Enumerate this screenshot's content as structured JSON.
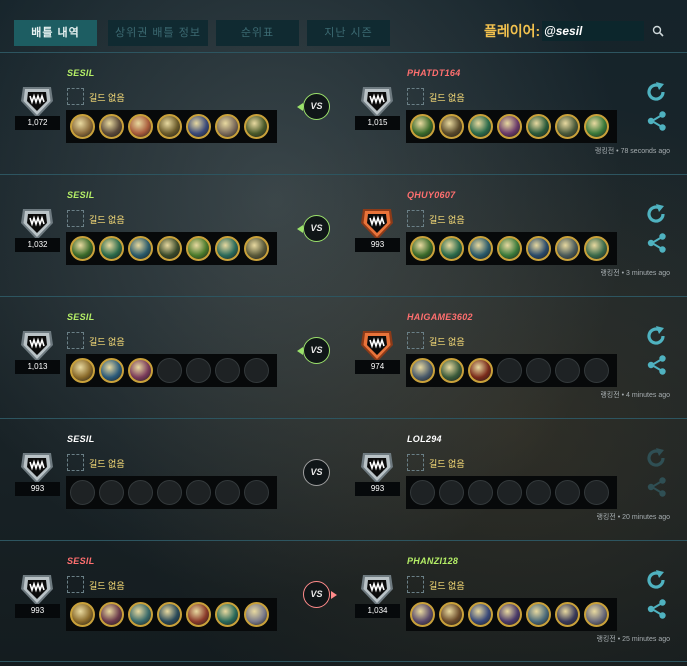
{
  "nav": {
    "tabs": [
      {
        "label": "배틀 내역",
        "active": true
      },
      {
        "label": "상위권 배틀 정보",
        "active": false
      },
      {
        "label": "순위표",
        "active": false
      },
      {
        "label": "지난 시즌",
        "active": false
      }
    ],
    "player_label": "플레이어:",
    "player_name": "@sesil",
    "search_icon": "search-icon"
  },
  "colors": {
    "accent": "#1d5d62",
    "win_name": "#b5ef67",
    "lose_name": "#ff6f6f",
    "neutral_name": "#ffffff",
    "guild_text": "#ffe27a"
  },
  "battles": [
    {
      "left": {
        "name": "SESIL",
        "result": "win",
        "rating": "1,072",
        "guild": "길드 없음",
        "badge": "bronze",
        "champs": [
          "#8a6a3a",
          "#5b4a3a",
          "#a85b3b",
          "#6a5a2a",
          "#3b4a7a",
          "#7a6a5a",
          "#4a5a2a"
        ]
      },
      "right": {
        "name": "PHATDT164",
        "result": "lose",
        "rating": "1,015",
        "guild": "길드 없음",
        "badge": "bronze",
        "champs": [
          "#3a6a2a",
          "#5a4a2a",
          "#2a6a4a",
          "#6a3a6a",
          "#2a5a3a",
          "#4a5a3a",
          "#3a7a3a"
        ]
      },
      "winner": "left",
      "vs": "VS",
      "time": "랭킹전 • 78 seconds ago"
    },
    {
      "left": {
        "name": "SESIL",
        "result": "win",
        "rating": "1,032",
        "guild": "길드 없음",
        "badge": "bronze",
        "champs": [
          "#3a6a2a",
          "#2a6a4a",
          "#2a5a6a",
          "#3a4a2a",
          "#4a7a2a",
          "#2a6a5a",
          "#5a5a3a"
        ]
      },
      "right": {
        "name": "QHUY0607",
        "result": "lose",
        "rating": "993",
        "guild": "길드 없음",
        "badge": "orange",
        "champs": [
          "#3a6a2a",
          "#2a6a4a",
          "#2a5a6a",
          "#3a7a3a",
          "#2a4a6a",
          "#4a5a5a",
          "#3a6a4a"
        ]
      },
      "winner": "left",
      "vs": "VS",
      "time": "랭킹전 • 3 minutes ago"
    },
    {
      "left": {
        "name": "SESIL",
        "result": "win",
        "rating": "1,013",
        "guild": "길드 없음",
        "badge": "bronze",
        "champs": [
          "#8a6a2a",
          "#2a5a7a",
          "#7a3a5a",
          "",
          "",
          "",
          ""
        ]
      },
      "right": {
        "name": "HAIGAME3602",
        "result": "lose",
        "rating": "974",
        "guild": "길드 없음",
        "badge": "orange",
        "champs": [
          "#4a5a6a",
          "#3a5a3a",
          "#7a2a1a",
          "",
          "",
          "",
          ""
        ]
      },
      "winner": "left",
      "vs": "VS",
      "time": "랭킹전 • 4 minutes ago"
    },
    {
      "left": {
        "name": "SESIL",
        "result": "none",
        "rating": "993",
        "guild": "길드 없음",
        "badge": "bronze",
        "champs": [
          "",
          "",
          "",
          "",
          "",
          "",
          ""
        ]
      },
      "right": {
        "name": "LOL294",
        "result": "none",
        "rating": "993",
        "guild": "길드 없음",
        "badge": "bronze",
        "champs": [
          "",
          "",
          "",
          "",
          "",
          "",
          ""
        ]
      },
      "winner": "none",
      "vs": "VS",
      "time": "랭킹전 • 20 minutes ago"
    },
    {
      "left": {
        "name": "SESIL",
        "result": "lose",
        "rating": "993",
        "guild": "길드 없음",
        "badge": "bronze",
        "champs": [
          "#8a6a2a",
          "#6a3a4a",
          "#3a6a6a",
          "#2a4a5a",
          "#8a3a2a",
          "#2a6a5a",
          "#7a7a8a"
        ]
      },
      "right": {
        "name": "PHANZI128",
        "result": "win",
        "rating": "1,034",
        "guild": "길드 없음",
        "badge": "bronze",
        "champs": [
          "#5a4a6a",
          "#6a4a2a",
          "#3a4a7a",
          "#4a3a6a",
          "#4a6a7a",
          "#3a3a5a",
          "#6a6a7a"
        ]
      },
      "winner": "right",
      "vs": "VS",
      "time": "랭킹전 • 25 minutes ago"
    }
  ]
}
